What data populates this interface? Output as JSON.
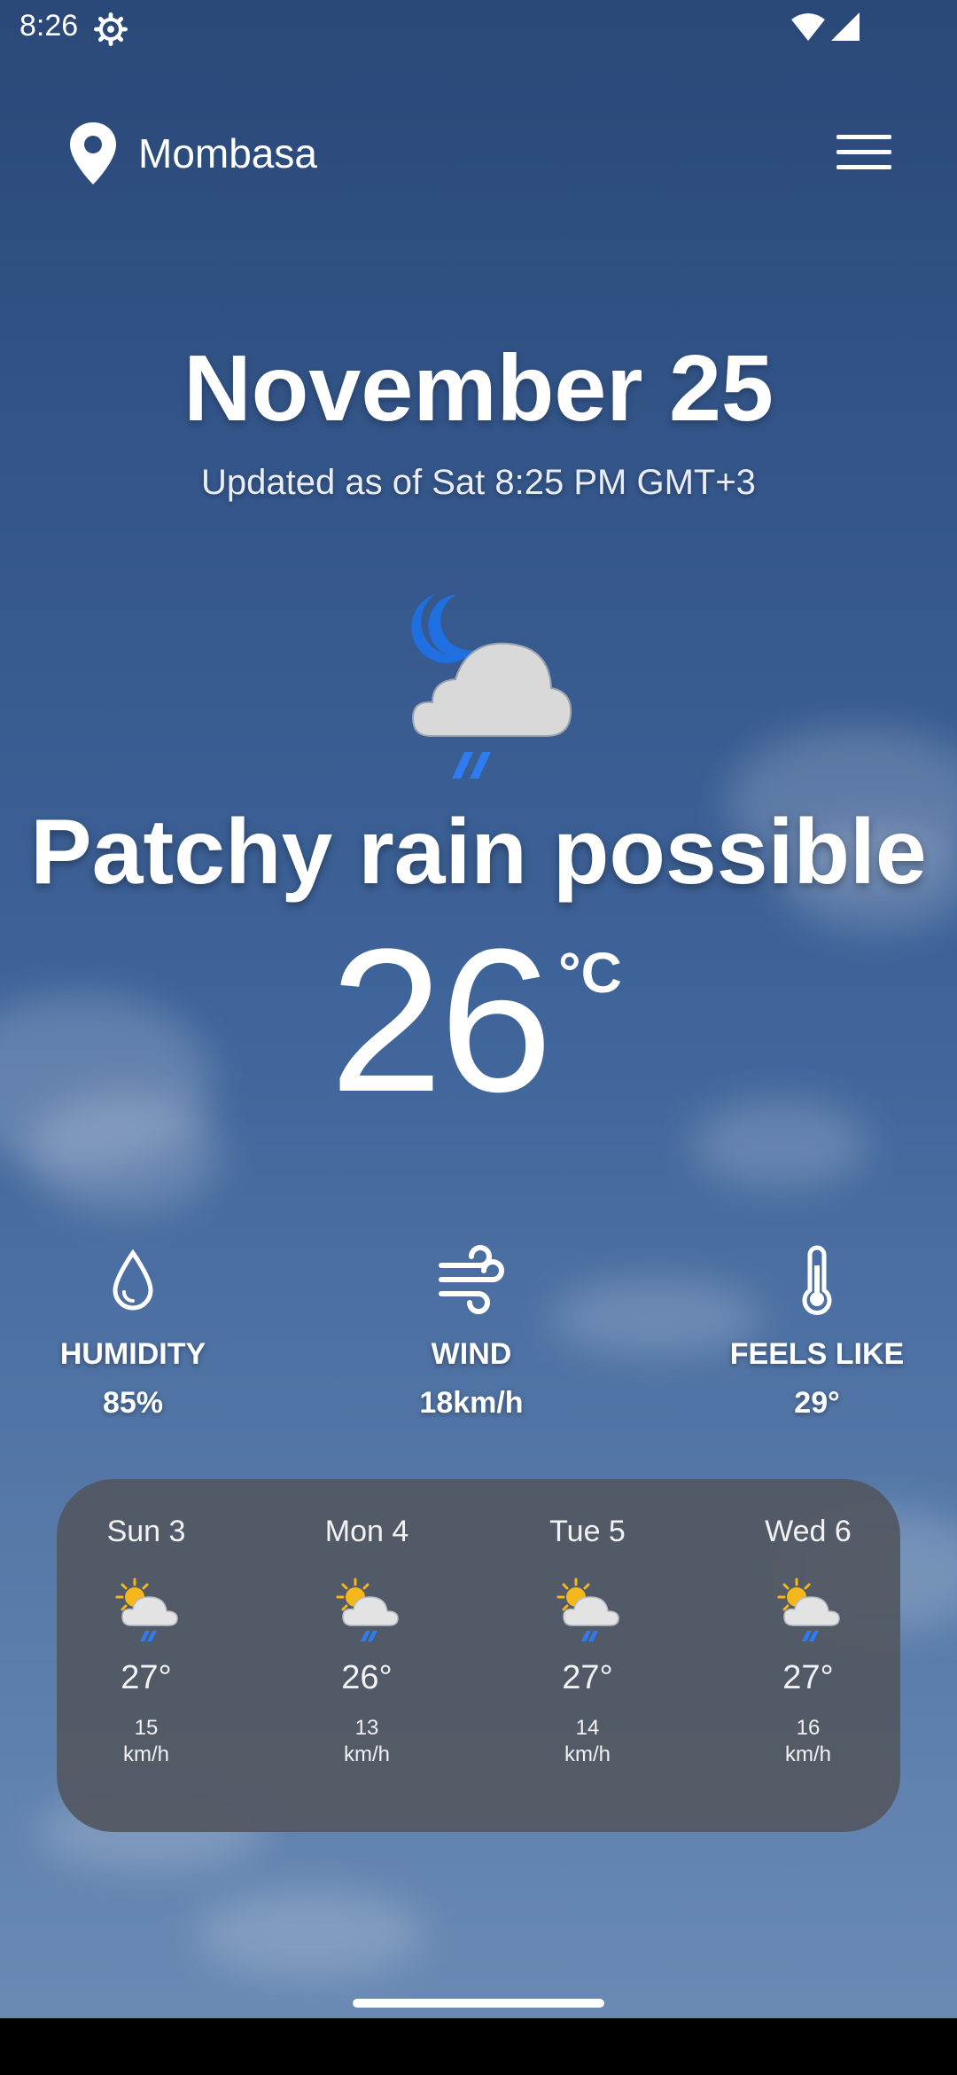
{
  "status_bar": {
    "time": "8:26",
    "icons": [
      "gear-icon",
      "wifi-icon",
      "signal-icon"
    ]
  },
  "header": {
    "location": "Mombasa",
    "location_icon": "location-pin-icon",
    "menu_icon": "hamburger-menu-icon"
  },
  "main": {
    "date": "November 25",
    "updated": "Updated as of Sat 8:25 PM GMT+3",
    "condition_icon": "moon-cloud-rain-icon",
    "condition": "Patchy rain possible",
    "temperature": "26",
    "unit": "°C"
  },
  "stats": [
    {
      "label": "HUMIDITY",
      "value": "85%",
      "icon": "droplet-icon"
    },
    {
      "label": "WIND",
      "value": "18km/h",
      "icon": "wind-icon"
    },
    {
      "label": "FEELS LIKE",
      "value": "29°",
      "icon": "thermometer-icon"
    }
  ],
  "forecast": [
    {
      "day": "Sun 3",
      "temp": "27°",
      "wind_value": "15",
      "wind_unit": "km/h",
      "icon": "sun-cloud-rain-icon"
    },
    {
      "day": "Mon 4",
      "temp": "26°",
      "wind_value": "13",
      "wind_unit": "km/h",
      "icon": "sun-cloud-rain-icon"
    },
    {
      "day": "Tue 5",
      "temp": "27°",
      "wind_value": "14",
      "wind_unit": "km/h",
      "icon": "sun-cloud-rain-icon"
    },
    {
      "day": "Wed 6",
      "temp": "27°",
      "wind_value": "16",
      "wind_unit": "km/h",
      "icon": "sun-cloud-rain-icon"
    }
  ],
  "colors": {
    "sky_top": "#2a4878",
    "sky_bottom": "#6a8ab4",
    "forecast_card": "#535863",
    "moon": "#1f6fe0",
    "sun": "#f5b71a",
    "rain": "#2f7cf0"
  }
}
